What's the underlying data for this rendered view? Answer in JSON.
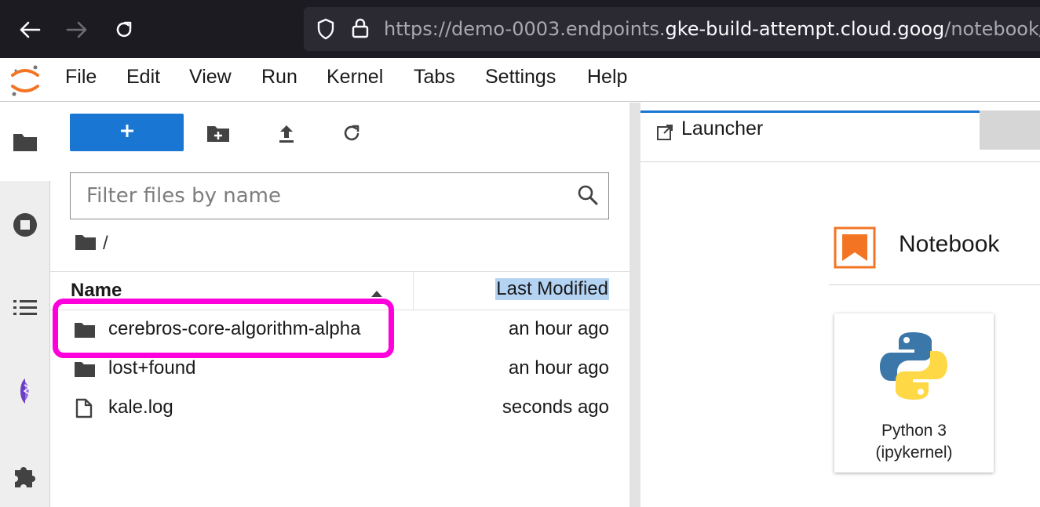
{
  "browser": {
    "url_prefix": "https://demo-0003.endpoints.",
    "url_host": "gke-build-attempt.cloud.goog",
    "url_suffix": "/notebook/"
  },
  "menu": [
    "File",
    "Edit",
    "View",
    "Run",
    "Kernel",
    "Tabs",
    "Settings",
    "Help"
  ],
  "filebrowser": {
    "filter_placeholder": "Filter files by name",
    "breadcrumb": "/",
    "columns": {
      "name": "Name",
      "modified": "Last Modified"
    },
    "rows": [
      {
        "name": "cerebros-core-algorithm-alpha",
        "modified": "an hour ago",
        "type": "folder"
      },
      {
        "name": "lost+found",
        "modified": "an hour ago",
        "type": "folder"
      },
      {
        "name": "kale.log",
        "modified": "seconds ago",
        "type": "file"
      }
    ]
  },
  "launcher": {
    "tab_label": "Launcher",
    "section_title": "Notebook",
    "kernel_card": {
      "line1": "Python 3",
      "line2": "(ipykernel)"
    }
  },
  "colors": {
    "accent": "#1976d2",
    "highlight": "#ff00dc",
    "notebook_icon": "#f37524"
  },
  "icons": [
    "back-arrow-icon",
    "forward-arrow-icon",
    "reload-icon",
    "shield-icon",
    "lock-icon",
    "jupyter-logo-icon",
    "folder-icon",
    "stop-circle-icon",
    "list-icon",
    "kale-icon",
    "puzzle-icon",
    "plus-icon",
    "new-folder-icon",
    "upload-icon",
    "refresh-icon",
    "search-icon",
    "sort-up-icon",
    "file-icon",
    "launcher-icon",
    "bookmark-icon",
    "python-logo-icon"
  ]
}
